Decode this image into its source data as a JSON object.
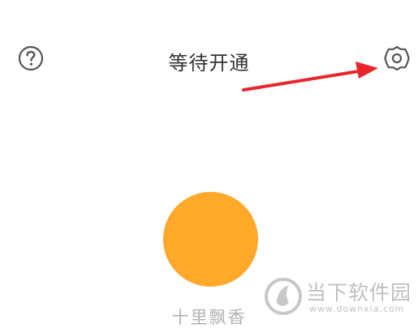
{
  "header": {
    "title": "等待开通",
    "help_icon": "question-circle-icon",
    "settings_icon": "gear-icon"
  },
  "annotation": {
    "arrow_color": "#e8262b"
  },
  "profile": {
    "avatar_color": "#ffa82a",
    "name": "十里飘香"
  },
  "watermark": {
    "name": "当下软件园",
    "url": "www.downxia.com",
    "color": "#8d8d8d"
  }
}
